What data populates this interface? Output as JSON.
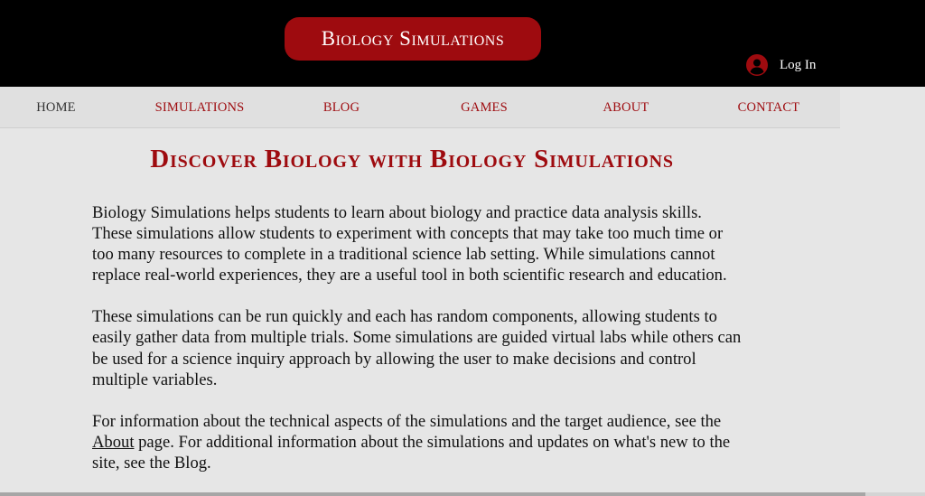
{
  "header": {
    "brand": "Biology Simulations",
    "login_label": "Log In",
    "background_color": "#000000",
    "brand_color": "#9e0b0f"
  },
  "nav": {
    "items": [
      {
        "label": "HOME",
        "active": true
      },
      {
        "label": "SIMULATIONS",
        "active": false
      },
      {
        "label": "BLOG",
        "active": false
      },
      {
        "label": "GAMES",
        "active": false
      },
      {
        "label": "ABOUT",
        "active": false
      },
      {
        "label": "CONTACT",
        "active": false
      }
    ]
  },
  "main": {
    "title": "Discover Biology with Biology Simulations",
    "paragraph1": "Biology Simulations helps students to learn about biology and practice data analysis skills. These simulations allow students to experiment with concepts that may take too much time or too many resources to complete in a traditional science lab setting. While simulations cannot replace real-world experiences, they are a useful tool in both scientific research and education.",
    "paragraph2": "These simulations can be run quickly and each has random components, allowing students to easily gather data from multiple trials. Some simulations are guided virtual labs while others can be used for a science inquiry approach by allowing the user to make decisions and control multiple variables.",
    "paragraph3": {
      "part1": "For information about the technical aspects of the simulations and the target audience, see the ",
      "about_link": "About",
      "part2": " page. For additional information about the simulations and updates on what's new to the site, see the Blog."
    }
  },
  "icons": {
    "login_avatar": "user-avatar-icon"
  }
}
